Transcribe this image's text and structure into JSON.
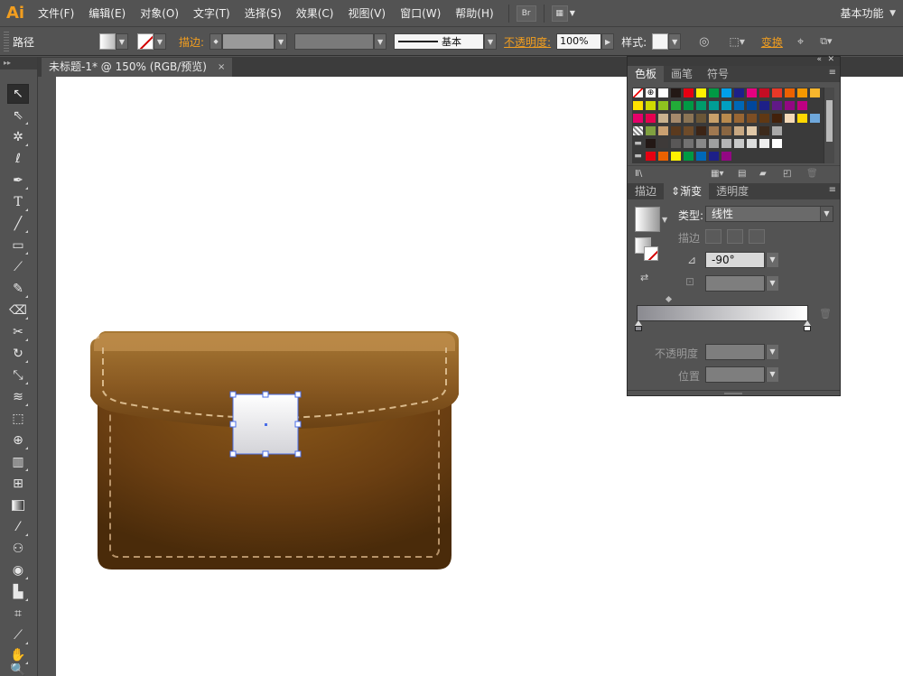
{
  "app": {
    "logo": "Ai",
    "menu": [
      "文件(F)",
      "编辑(E)",
      "对象(O)",
      "文字(T)",
      "选择(S)",
      "效果(C)",
      "视图(V)",
      "窗口(W)",
      "帮助(H)"
    ],
    "bridge_label": "Br",
    "workspace": "基本功能"
  },
  "control_bar": {
    "selection_type": "路径",
    "stroke_label": "描边:",
    "stroke_style": "基本",
    "opacity_label": "不透明度:",
    "opacity_value": "100%",
    "style_label": "样式:",
    "transform_label": "变换"
  },
  "document": {
    "tab_title": "未标题-1* @ 150% (RGB/预览)",
    "close_glyph": "×"
  },
  "swatches_panel": {
    "tabs": [
      "色板",
      "画笔",
      "符号"
    ],
    "active_tab": "色板",
    "rows": [
      [
        "none",
        "registration",
        "#ffffff",
        "#231815",
        "#e60012",
        "#fff100",
        "#009944",
        "#00a0e9",
        "#1d2088",
        "#e4007f",
        "#c30d23",
        "#e83828",
        "#eb6100",
        "#f39800",
        "#f8b62d"
      ],
      [
        "#ffe100",
        "#cfdb00",
        "#8fc31f",
        "#22ac38",
        "#009944",
        "#009b6b",
        "#009e96",
        "#00a0c1",
        "#0068b7",
        "#00479d",
        "#1d2088",
        "#601986",
        "#920783",
        "#be0081"
      ],
      [
        "#e5006a",
        "#e5004f",
        "#c9b28e",
        "#a58a6c",
        "#8b7455",
        "#6a5637",
        "#c7a06a",
        "#b98a4d",
        "#996633",
        "#7d4e24",
        "#603813",
        "#42210b",
        "#f4d9b8",
        "#ffd700",
        "#6fa8dc"
      ],
      [
        "pattern",
        "#80a040",
        "#c9a071",
        "#5b3a1e",
        "#6e4b2a",
        "#3c2415",
        "#a07850",
        "#8a6642",
        "#c8a882",
        "#e0c8a8",
        "#3c2a1c",
        "#a9a9a9"
      ],
      [
        "folder",
        "#231815",
        "#3e3a39",
        "#595757",
        "#727171",
        "#898989",
        "#9fa0a0",
        "#b5b5b6",
        "#c9caca",
        "#dcdddd",
        "#efefef",
        "#ffffff"
      ],
      [
        "folder",
        "#e60012",
        "#eb6100",
        "#fff100",
        "#009944",
        "#0068b7",
        "#1d2088",
        "#920783"
      ]
    ]
  },
  "gradient_panel": {
    "tabs": [
      "描边",
      "渐变",
      "透明度"
    ],
    "active_tab": "渐变",
    "type_label": "类型:",
    "type_value": "线性",
    "stroke_label": "描边",
    "angle_value": "-90°",
    "opacity_label": "不透明度",
    "location_label": "位置",
    "gradient_start": "#8a8a90",
    "gradient_end": "#ffffff"
  },
  "colors": {
    "accent": "#f29e1f",
    "selection": "#4a6ee8",
    "bag_light": "#a87935",
    "bag_dark": "#4a2b0a"
  },
  "icons": {
    "tools": [
      "selection-icon",
      "direct-selection-icon",
      "magic-wand-icon",
      "lasso-icon",
      "pen-icon",
      "type-icon",
      "line-icon",
      "rectangle-icon",
      "paintbrush-icon",
      "pencil-icon",
      "blob-brush-icon",
      "scissors-icon",
      "rotate-icon",
      "scale-icon",
      "width-icon",
      "free-transform-icon",
      "shape-builder-icon",
      "perspective-grid-icon",
      "mesh-icon",
      "gradient-icon",
      "eyedropper-icon",
      "blend-icon",
      "symbol-sprayer-icon",
      "column-graph-icon",
      "artboard-icon",
      "slice-icon",
      "hand-icon",
      "zoom-icon"
    ]
  }
}
